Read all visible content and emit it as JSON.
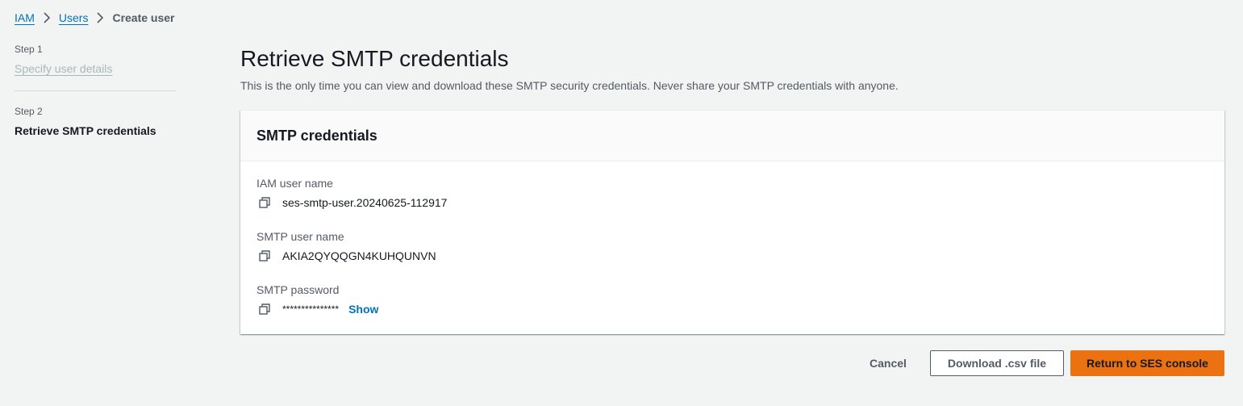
{
  "breadcrumb": {
    "items": [
      {
        "label": "IAM",
        "link": true
      },
      {
        "label": "Users",
        "link": true
      },
      {
        "label": "Create user",
        "link": false
      }
    ]
  },
  "steps": [
    {
      "number": "Step 1",
      "label": "Specify user details",
      "state": "disabled"
    },
    {
      "number": "Step 2",
      "label": "Retrieve SMTP credentials",
      "state": "current"
    }
  ],
  "page": {
    "title": "Retrieve SMTP credentials",
    "description": "This is the only time you can view and download these SMTP security credentials. Never share your SMTP credentials with anyone."
  },
  "panel": {
    "title": "SMTP credentials",
    "fields": {
      "iam_user_name": {
        "label": "IAM user name",
        "value": "ses-smtp-user.20240625-112917"
      },
      "smtp_user_name": {
        "label": "SMTP user name",
        "value": "AKIA2QYQQGN4KUHQUNVN"
      },
      "smtp_password": {
        "label": "SMTP password",
        "value": "***************",
        "show_label": "Show"
      }
    }
  },
  "actions": {
    "cancel_label": "Cancel",
    "download_label": "Download .csv file",
    "return_label": "Return to SES console"
  },
  "colors": {
    "background": "#f2f3f3",
    "link": "#0073bb",
    "primary_button": "#ec7211",
    "text": "#16191f",
    "secondary_text": "#545b64"
  },
  "icons": {
    "breadcrumb_separator": "chevron-right-icon",
    "copy": "copy-icon"
  }
}
